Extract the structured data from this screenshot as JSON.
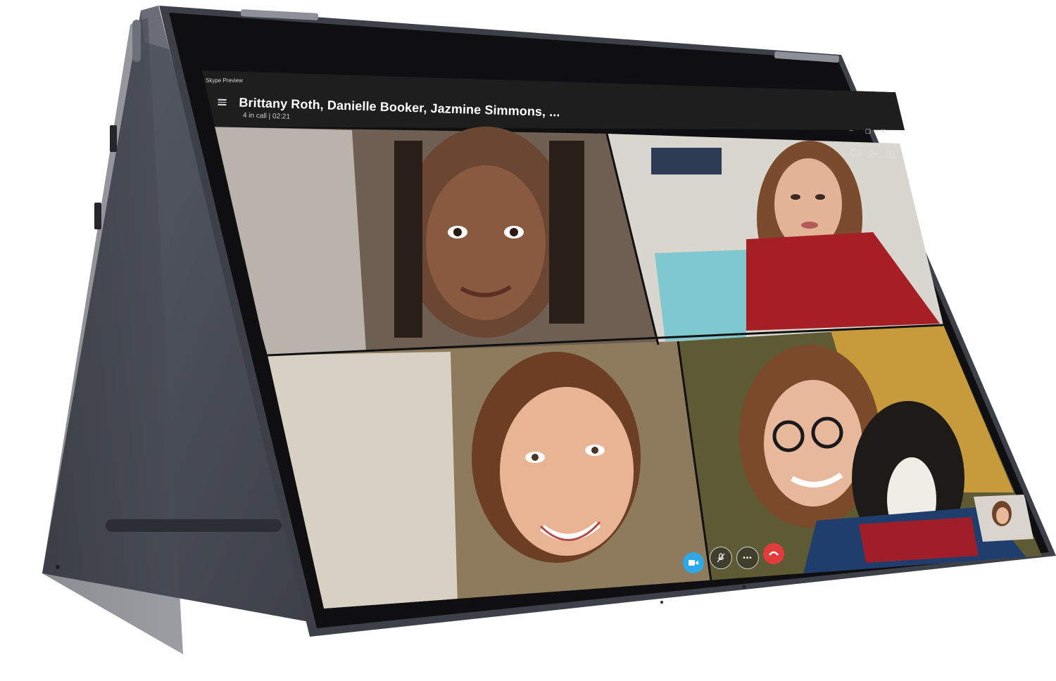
{
  "app": {
    "window_title": "Skype Preview",
    "call_title": "Brittany Roth, Danielle Booker, Jazmine Simmons, ...",
    "call_status": "4 in call | 02:21"
  },
  "window_controls": {
    "minimize": "–",
    "restore": "▢",
    "close": "✕"
  },
  "header_icons": [
    "chat-icon",
    "add-person-icon",
    "share-screen-icon"
  ],
  "call_controls": {
    "video": "video-camera-icon",
    "mic": "mute-microphone-icon",
    "more": "•••",
    "end": "end-call-icon"
  },
  "colors": {
    "device_body": "#4a4d57",
    "screen_bezel": "#0f0f12",
    "app_header": "#1e1e1e",
    "video_button": "#2ea8e6",
    "end_call_button": "#e23b3b"
  }
}
